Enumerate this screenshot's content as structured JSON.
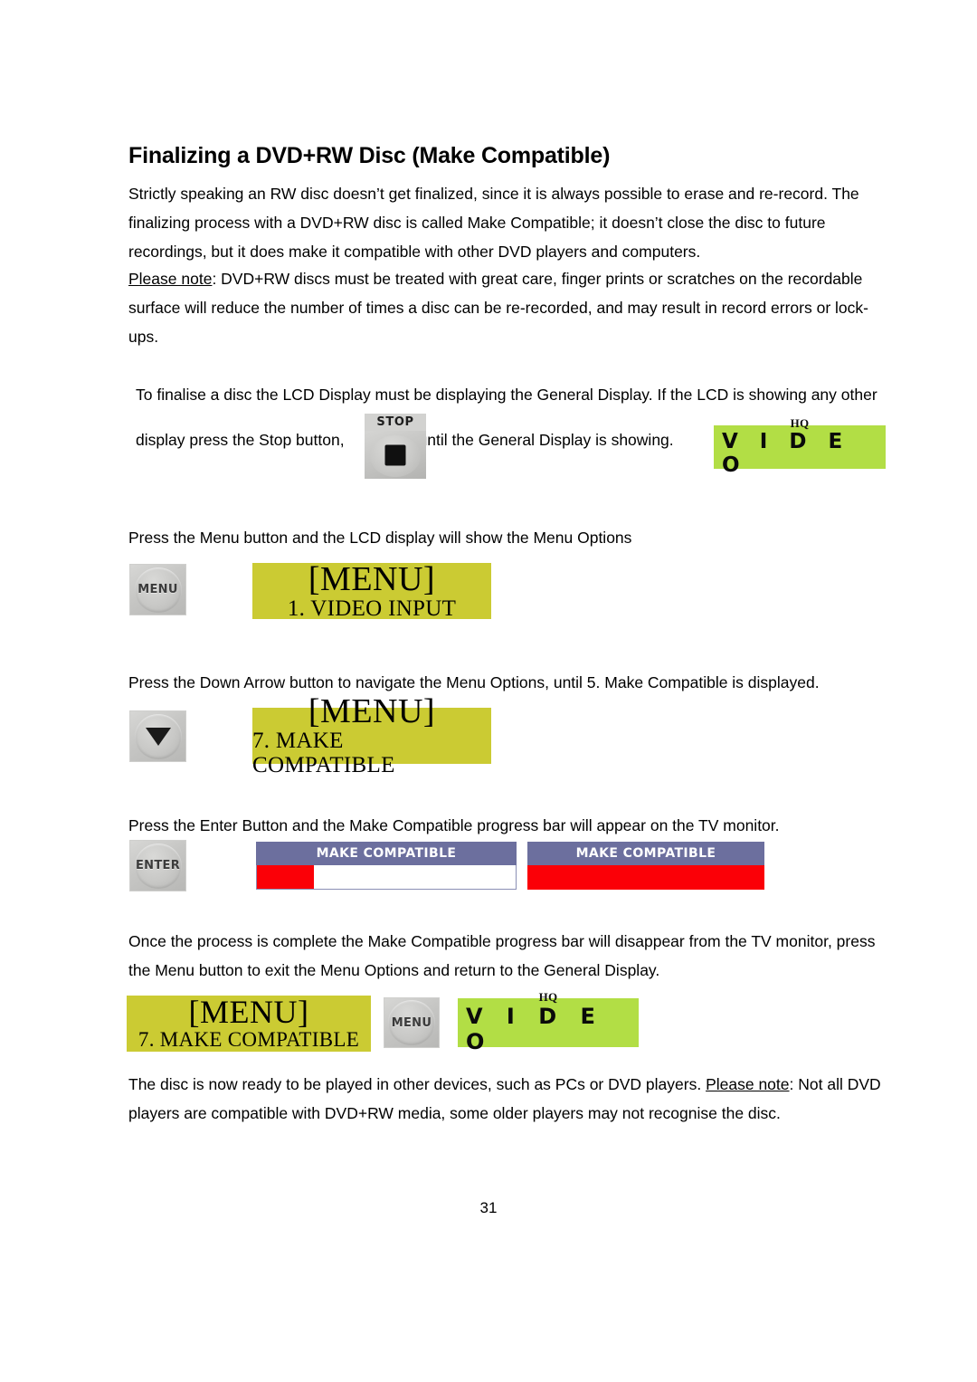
{
  "document": {
    "heading": "Finalizing a DVD+RW Disc (Make Compatible)",
    "page_number": "31",
    "paragraphs": {
      "intro": "Strictly speaking an RW disc doesn’t get finalized, since it is always possible to erase and re-record. The finalizing process with a DVD+RW disc is called Make Compatible; it doesn’t close the disc to future recordings, but it does make it compatible with other DVD players and computers.",
      "note_label": "Please note",
      "note_body": ": DVD+RW discs must be treated with great care, finger prints or scratches on the recordable surface will reduce the number of times a disc can be re-recorded, and may result in record errors or lock-ups.",
      "lcd_intro": "To finalise a disc the LCD Display must be displaying the General Display. If the LCD is showing any other",
      "stop_line_part1": "display press the Stop button,",
      "stop_line_part2": "until the General Display is showing.",
      "menu_instruction": "Press the Menu button and the LCD display will show the Menu Options",
      "down_instruction": "Press the Down Arrow button to navigate the Menu Options, until 5. Make Compatible is displayed.",
      "enter_instruction": "Press the Enter Button and the Make Compatible progress bar will appear on the TV monitor.",
      "once_complete": "Once the process is complete the Make Compatible progress bar will disappear from the TV monitor, press the Menu button to exit the Menu Options and return to the General Display.",
      "final_part1": "The disc is now ready to be played in other devices, such as PCs or DVD players. ",
      "final_note_label": "Please note",
      "final_part2": ": Not all DVD players are compatible with DVD+RW media, some older players may not recognise the disc."
    }
  },
  "buttons": {
    "stop": {
      "label": "STOP",
      "icon": "stop-square-icon"
    },
    "menu_1": {
      "label": "MENU"
    },
    "down": {
      "label": "",
      "icon": "down-arrow-icon"
    },
    "enter": {
      "label": "ENTER"
    },
    "menu_2": {
      "label": "MENU"
    }
  },
  "displays": {
    "general_display_1": {
      "top_text": "HQ",
      "main_text": "V I D E O",
      "bg_color": "#b2de45"
    },
    "general_display_2": {
      "top_text": "HQ",
      "main_text": "V I D E O",
      "bg_color": "#b2de45"
    },
    "menu_display_1": {
      "line1": "[MENU]",
      "line2": "1. VIDEO INPUT",
      "bg_color": "#cbcb33"
    },
    "menu_display_2": {
      "line1": "[MENU]",
      "line2": "7. MAKE COMPATIBLE",
      "bg_color": "#cbcb33"
    },
    "menu_display_3": {
      "line1": "[MENU]",
      "line2": "7. MAKE COMPATIBLE",
      "bg_color": "#cbcb33"
    }
  },
  "progress_bars": {
    "bar_start": {
      "title": "MAKE COMPATIBLE",
      "percent": 22,
      "fill_color": "#fb0007",
      "header_color": "#6c6f9e"
    },
    "bar_complete": {
      "title": "MAKE COMPATIBLE",
      "percent": 100,
      "fill_color": "#fb0007",
      "header_color": "#6c6f9e"
    }
  }
}
